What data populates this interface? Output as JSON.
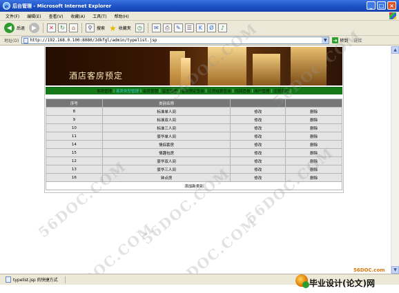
{
  "window": {
    "title": "后台管理 - Microsoft Internet Explorer"
  },
  "menubar": [
    "文件(F)",
    "编辑(E)",
    "查看(V)",
    "收藏(A)",
    "工具(T)",
    "帮助(H)"
  ],
  "toolbar": {
    "back_label": "后退",
    "search_label": "搜索",
    "favorites_label": "收藏夹"
  },
  "address": {
    "label": "地址(D)",
    "url": "http://192.168.0.100:8080/Jdkfgl/admin/typelist.jsp",
    "go_label": "转到",
    "links_label": "链接"
  },
  "banner": {
    "title": "酒店客房预定"
  },
  "nav": {
    "items": [
      "客房管理",
      "客房类型管理",
      "会员管理",
      "留言管理",
      "客房预定查询",
      "订房结算查询",
      "找回查看",
      "用户管理",
      "注销退出"
    ],
    "active_index": 1
  },
  "table": {
    "headers": [
      "序号",
      "类别名称",
      "",
      ""
    ],
    "rows": [
      {
        "id": "8",
        "name": "标准单人间",
        "edit": "修改",
        "del": "删除"
      },
      {
        "id": "9",
        "name": "标准双人间",
        "edit": "修改",
        "del": "删除"
      },
      {
        "id": "10",
        "name": "标准三人间",
        "edit": "修改",
        "del": "删除"
      },
      {
        "id": "11",
        "name": "豪华单人间",
        "edit": "修改",
        "del": "删除"
      },
      {
        "id": "14",
        "name": "情侣套房",
        "edit": "修改",
        "del": "删除"
      },
      {
        "id": "15",
        "name": "情趣包房",
        "edit": "修改",
        "del": "删除"
      },
      {
        "id": "12",
        "name": "豪华双人间",
        "edit": "修改",
        "del": "删除"
      },
      {
        "id": "13",
        "name": "豪华三人间",
        "edit": "修改",
        "del": "删除"
      },
      {
        "id": "16",
        "name": "钟点房",
        "edit": "修改",
        "del": "删除"
      }
    ],
    "add_label": "添加新类别"
  },
  "status": {
    "text": "typelist.jsp  的快捷方式"
  },
  "watermark": {
    "text": "56DOC.COM"
  },
  "branding": {
    "site": "56DOC.com",
    "name": "毕业设计(论文)网"
  },
  "colors": {
    "nav_green": "#137a17",
    "nav_active": "#39c7d8",
    "header_gray": "#767676",
    "row_gray": "#e4e4e4",
    "brand_orange": "#d8760a"
  }
}
